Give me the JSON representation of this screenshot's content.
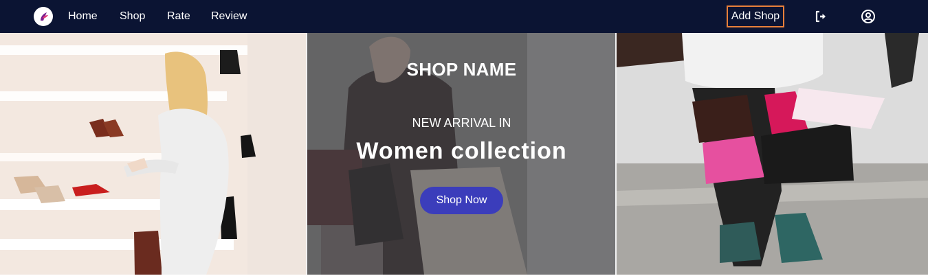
{
  "nav": {
    "logo_icon": "brand-logo-icon",
    "links": [
      {
        "label": "Home"
      },
      {
        "label": "Shop"
      },
      {
        "label": "Rate"
      },
      {
        "label": "Review"
      }
    ],
    "add_shop_label": "Add Shop",
    "logout_icon": "logout-icon",
    "account_icon": "account-icon"
  },
  "hero": {
    "shop_name": "SHOP NAME",
    "subtitle": "NEW ARRIVAL IN",
    "title": "Women collection",
    "cta_label": "Shop Now"
  },
  "colors": {
    "nav_bg": "#0b1433",
    "accent_border": "#e8803a",
    "cta_bg": "#3b3dbb"
  }
}
